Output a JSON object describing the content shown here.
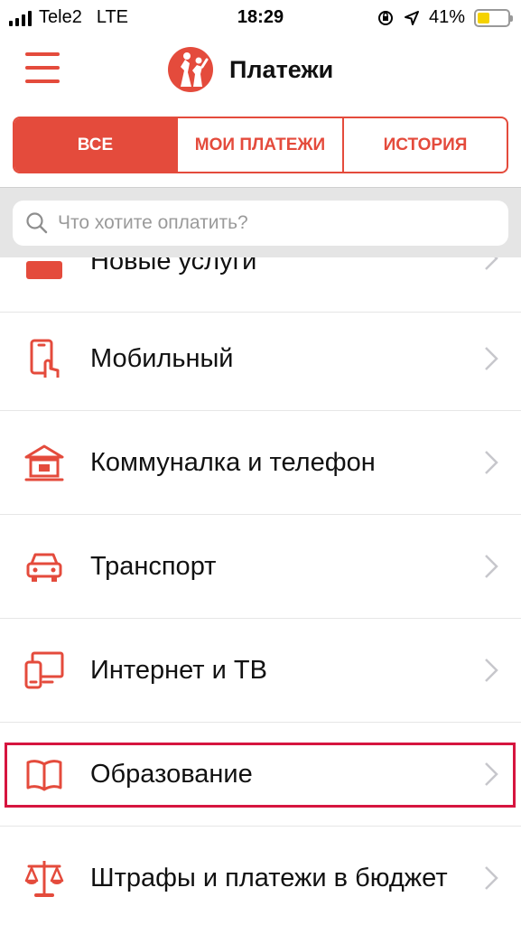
{
  "status_bar": {
    "carrier": "Tele2",
    "network": "LTE",
    "time": "18:29",
    "battery": "41%",
    "battery_level": 0.41
  },
  "header": {
    "title": "Платежи"
  },
  "tabs": [
    {
      "label": "ВСЕ",
      "active": true
    },
    {
      "label": "МОИ ПЛАТЕЖИ",
      "active": false
    },
    {
      "label": "ИСТОРИЯ",
      "active": false
    }
  ],
  "search": {
    "placeholder": "Что хотите оплатить?"
  },
  "categories": [
    {
      "label": "Новые услуги",
      "icon": "new-badge-icon"
    },
    {
      "label": "Мобильный",
      "icon": "mobile-phone-icon"
    },
    {
      "label": "Коммуналка и телефон",
      "icon": "house-icon"
    },
    {
      "label": "Транспорт",
      "icon": "car-icon"
    },
    {
      "label": "Интернет и ТВ",
      "icon": "internet-tv-icon"
    },
    {
      "label": "Образование",
      "icon": "book-icon"
    },
    {
      "label": "Штрафы и платежи в бюджет",
      "icon": "scales-icon"
    }
  ],
  "colors": {
    "accent": "#e44b3c",
    "highlight": "#d6153f",
    "search_bg": "#e5e5e5"
  }
}
